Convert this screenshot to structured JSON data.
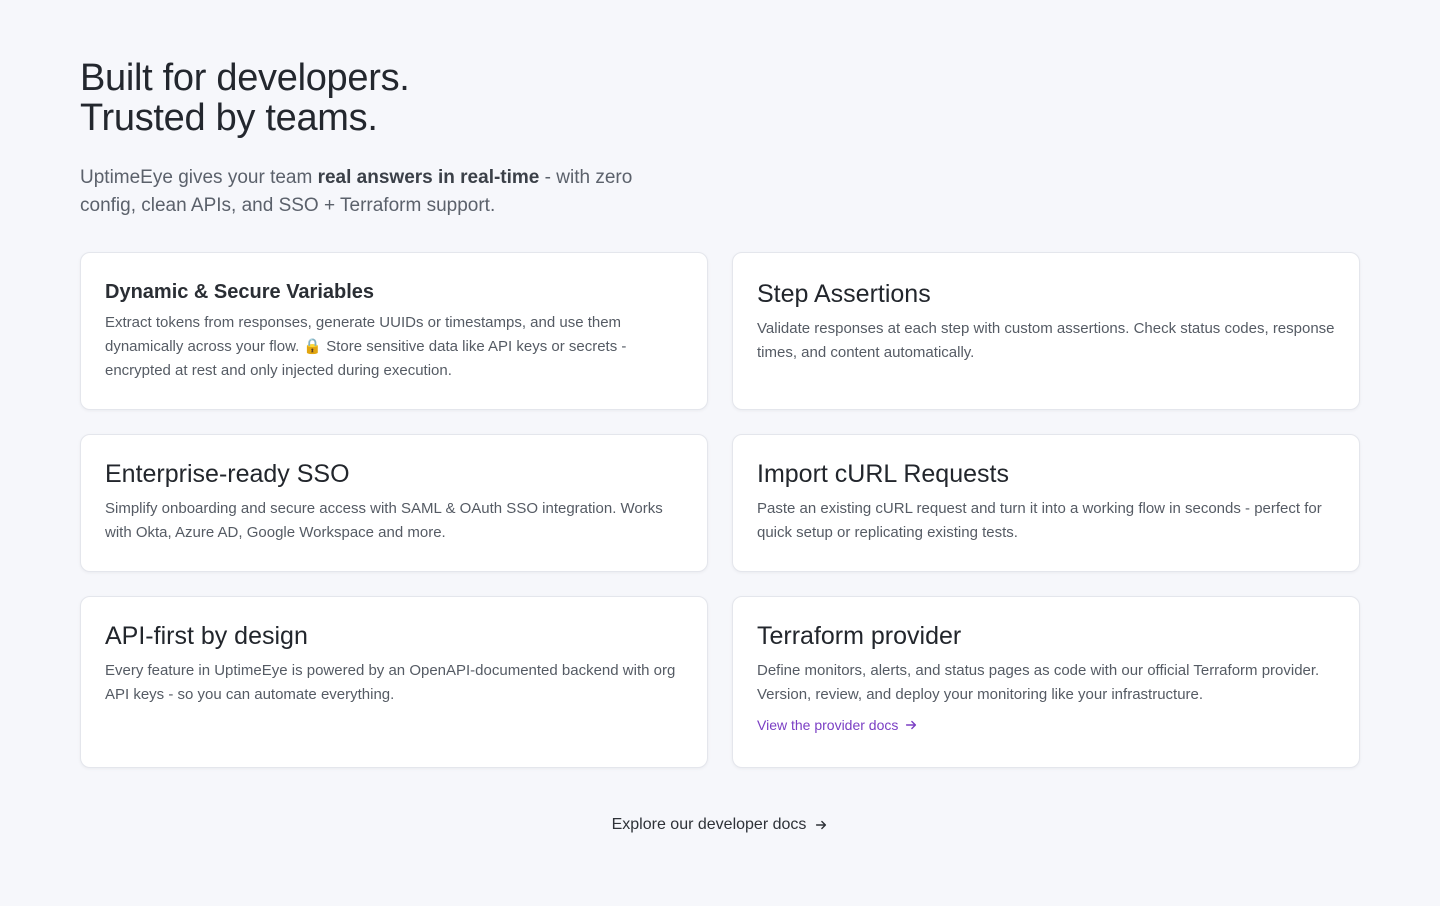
{
  "heading": {
    "line1": "Built for developers.",
    "line2": "Trusted by teams."
  },
  "intro": {
    "before": "UptimeEye gives your team ",
    "strong": "real answers in real-time",
    "after": " - with zero config, clean APIs, and SSO + Terraform support."
  },
  "features": [
    {
      "title": "Dynamic & Secure Variables",
      "body": "Extract tokens from responses, generate UUIDs or timestamps, and use them dynamically across your flow. 🔒 Store sensitive data like API keys or secrets - encrypted at rest and only injected during execution."
    },
    {
      "title": "Step Assertions",
      "body": "Validate responses at each step with custom assertions. Check status codes, response times, and content automatically."
    },
    {
      "title": "Enterprise-ready SSO",
      "body": "Simplify onboarding and secure access with SAML & OAuth SSO integration. Works with Okta, Azure AD, Google Workspace and more."
    },
    {
      "title": "Import cURL Requests",
      "body": "Paste an existing cURL request and turn it into a working flow in seconds - perfect for quick setup or replicating existing tests."
    },
    {
      "title": "API-first by design",
      "body": "Every feature in UptimeEye is powered by an OpenAPI-documented backend with org API keys - so you can automate everything."
    },
    {
      "title": "Terraform provider",
      "body": "Define monitors, alerts, and status pages as code with our official Terraform provider. Version, review, and deploy your monitoring like your infrastructure.",
      "link": "View the provider docs"
    }
  ],
  "explore": {
    "label": "Explore our developer docs"
  },
  "colors": {
    "background": "#f6f7fb",
    "link": "#7b3fc4"
  },
  "icons": {
    "arrow": "arrow-right-icon"
  }
}
